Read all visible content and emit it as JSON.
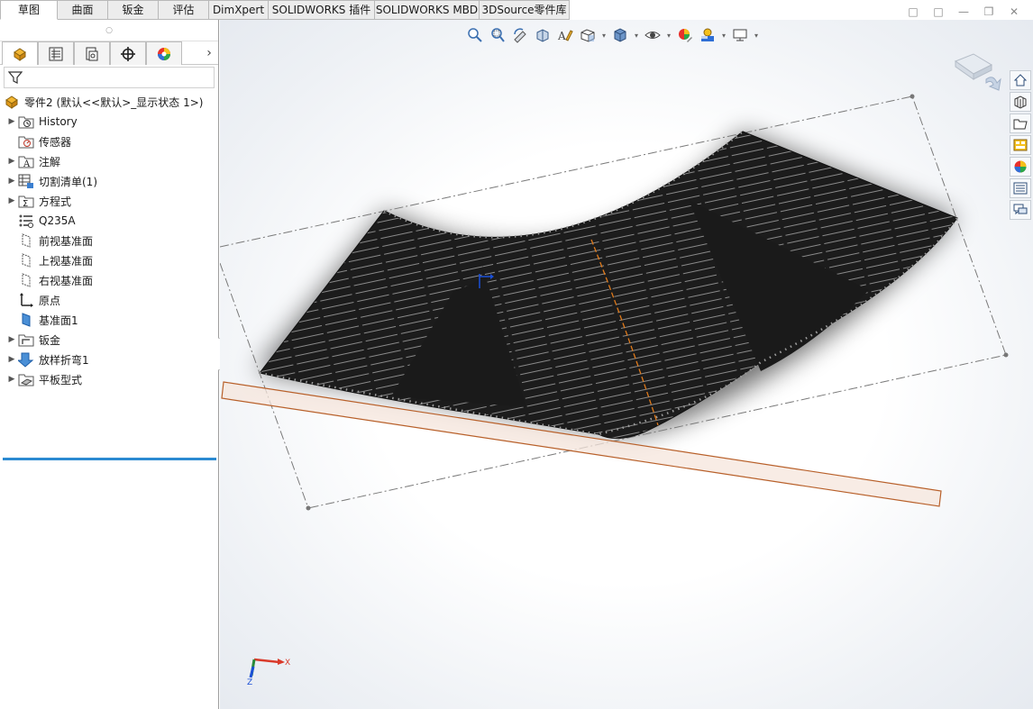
{
  "tabs": [
    {
      "label": "草图",
      "active": true
    },
    {
      "label": "曲面"
    },
    {
      "label": "钣金"
    },
    {
      "label": "评估"
    },
    {
      "label": "DimXpert"
    },
    {
      "label": "SOLIDWORKS 插件"
    },
    {
      "label": "SOLIDWORKS MBD"
    },
    {
      "label": "3DSource零件库"
    }
  ],
  "window_controls": [
    "prev-window-icon",
    "next-window-icon",
    "minimize-icon",
    "restore-icon",
    "close-icon"
  ],
  "manager_tabs": [
    "feature-manager-icon",
    "property-manager-icon",
    "configuration-manager-icon",
    "dimxpert-manager-icon",
    "display-manager-icon"
  ],
  "tree": {
    "root_label": "零件2  (默认<<默认>_显示状态 1>)",
    "items": [
      {
        "label": "History",
        "icon": "history-folder-icon",
        "expandable": true
      },
      {
        "label": "传感器",
        "icon": "sensor-icon",
        "expandable": false
      },
      {
        "label": "注解",
        "icon": "annotation-icon",
        "expandable": true
      },
      {
        "label": "切割清单(1)",
        "icon": "cut-list-icon",
        "expandable": true
      },
      {
        "label": "方程式",
        "icon": "equation-icon",
        "expandable": true
      },
      {
        "label": "Q235A",
        "icon": "material-icon",
        "expandable": false
      },
      {
        "label": "前视基准面",
        "icon": "plane-icon",
        "expandable": false
      },
      {
        "label": "上视基准面",
        "icon": "plane-icon",
        "expandable": false
      },
      {
        "label": "右视基准面",
        "icon": "plane-icon",
        "expandable": false
      },
      {
        "label": "原点",
        "icon": "origin-icon",
        "expandable": false
      },
      {
        "label": "基准面1",
        "icon": "plane-blue-icon",
        "expandable": false
      },
      {
        "label": "钣金",
        "icon": "sheetmetal-folder-icon",
        "expandable": true
      },
      {
        "label": "放样折弯1",
        "icon": "lofted-bend-icon",
        "expandable": true
      },
      {
        "label": "平板型式",
        "icon": "flat-pattern-icon",
        "expandable": true
      }
    ]
  },
  "heads_up_toolbar": [
    "zoom-to-fit-icon",
    "zoom-to-area-icon",
    "previous-view-icon",
    "section-view-icon",
    "dynamic-annotation-icon",
    "view-orientation-icon",
    "display-style-icon",
    "hide-show-items-icon",
    "edit-appearance-icon",
    "apply-scene-icon",
    "view-settings-icon"
  ],
  "task_pane": [
    "home-icon",
    "design-library-icon",
    "file-explorer-icon",
    "view-palette-icon",
    "appearances-icon",
    "custom-properties-icon",
    "forum-icon"
  ],
  "triad_labels": {
    "x": "X",
    "z": "Z"
  },
  "colors": {
    "accent": "#2b8ad1",
    "model": "#1c1c1c",
    "bend_line": "#e07a1a",
    "plane": "#b8602a"
  }
}
